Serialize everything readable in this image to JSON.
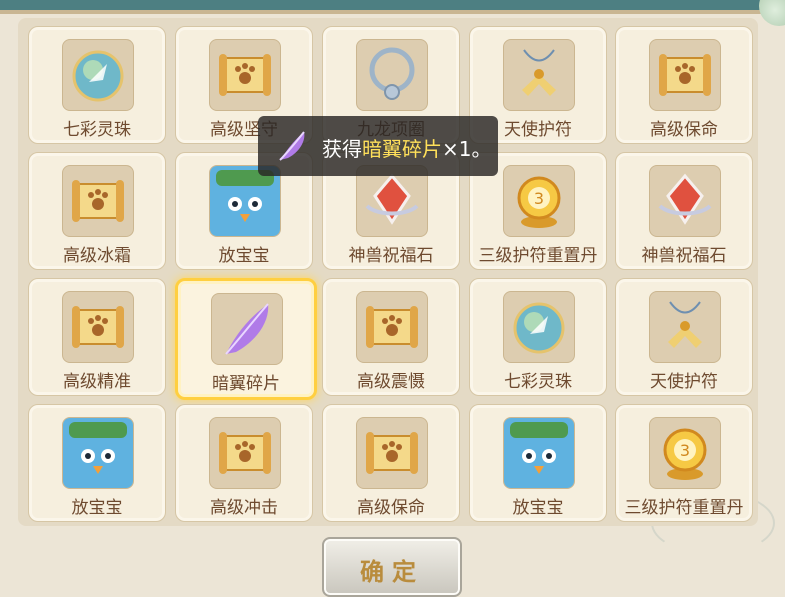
{
  "items": [
    {
      "name": "七彩灵珠",
      "icon": "orb-icon",
      "selected": false
    },
    {
      "name": "高级坚守",
      "icon": "scroll-icon",
      "selected": false
    },
    {
      "name": "九龙项圈",
      "icon": "necklace-icon",
      "selected": false
    },
    {
      "name": "天使护符",
      "icon": "wing-amulet-icon",
      "selected": false
    },
    {
      "name": "高级保命",
      "icon": "scroll-icon",
      "selected": false
    },
    {
      "name": "高级冰霜",
      "icon": "scroll-icon",
      "selected": false
    },
    {
      "name": "放宝宝",
      "icon": "penguin-icon",
      "selected": false
    },
    {
      "name": "神兽祝福石",
      "icon": "gem-icon",
      "selected": false
    },
    {
      "name": "三级护符重置丹",
      "icon": "gold-orb-icon",
      "selected": false
    },
    {
      "name": "神兽祝福石",
      "icon": "gem-icon",
      "selected": false
    },
    {
      "name": "高级精准",
      "icon": "scroll-icon",
      "selected": false
    },
    {
      "name": "暗翼碎片",
      "icon": "feather-icon",
      "selected": true
    },
    {
      "name": "高级震慑",
      "icon": "scroll-icon",
      "selected": false
    },
    {
      "name": "七彩灵珠",
      "icon": "orb-icon",
      "selected": false
    },
    {
      "name": "天使护符",
      "icon": "wing-amulet-icon",
      "selected": false
    },
    {
      "name": "放宝宝",
      "icon": "penguin-icon",
      "selected": false
    },
    {
      "name": "高级冲击",
      "icon": "scroll-icon",
      "selected": false
    },
    {
      "name": "高级保命",
      "icon": "scroll-icon",
      "selected": false
    },
    {
      "name": "放宝宝",
      "icon": "penguin-icon",
      "selected": false
    },
    {
      "name": "三级护符重置丹",
      "icon": "gold-orb-icon",
      "selected": false
    }
  ],
  "toast": {
    "prefix": "获得",
    "item": "暗翼碎片",
    "suffix": "×1。",
    "icon": "feather-icon"
  },
  "confirm_label": "确定",
  "colors": {
    "accent": "#ffcf40",
    "item_text": "#6e4a2f",
    "toast_highlight": "#ffe05a"
  }
}
